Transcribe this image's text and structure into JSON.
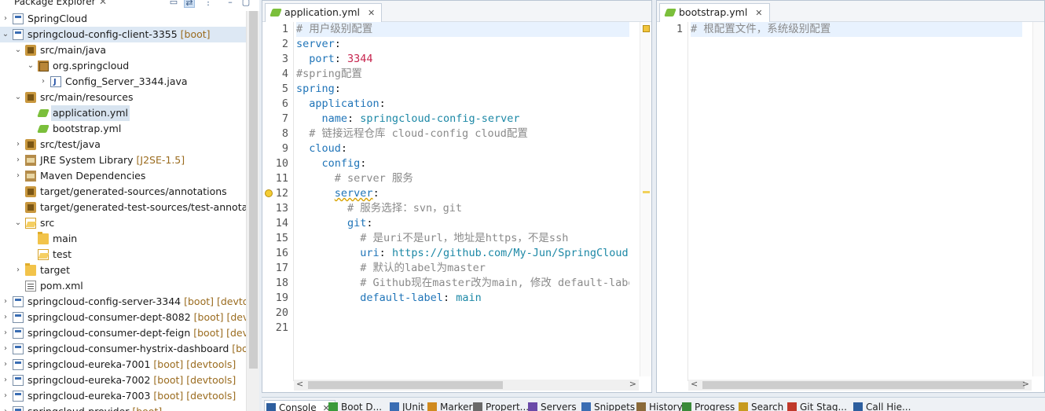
{
  "explorer": {
    "title": "Package Explorer",
    "close": "✕",
    "menu": "⋮",
    "rows": [
      {
        "label": "SpringCloud",
        "deco": "",
        "depth": 0,
        "twisty": "›",
        "icon": "ic-proj",
        "icon_name": "project-icon"
      },
      {
        "label": "springcloud-config-client-3355",
        "deco": " [boot]",
        "depth": 0,
        "twisty": "⌄",
        "icon": "ic-proj",
        "icon_name": "boot-project-icon",
        "highlight": true
      },
      {
        "label": "src/main/java",
        "deco": "",
        "depth": 1,
        "twisty": "⌄",
        "icon": "ic-pkgroot",
        "icon_name": "source-folder-icon"
      },
      {
        "label": "org.springcloud",
        "deco": "",
        "depth": 2,
        "twisty": "⌄",
        "icon": "ic-pkg",
        "icon_name": "package-icon"
      },
      {
        "label": "Config_Server_3344.java",
        "deco": "",
        "depth": 3,
        "twisty": "›",
        "icon": "ic-java",
        "icon_name": "java-file-icon"
      },
      {
        "label": "src/main/resources",
        "deco": "",
        "depth": 1,
        "twisty": "⌄",
        "icon": "ic-pkgroot",
        "icon_name": "source-folder-icon"
      },
      {
        "label": "application.yml",
        "deco": "",
        "depth": 2,
        "twisty": "",
        "icon": "ic-yml",
        "icon_name": "yaml-file-icon",
        "selected": true
      },
      {
        "label": "bootstrap.yml",
        "deco": "",
        "depth": 2,
        "twisty": "",
        "icon": "ic-yml",
        "icon_name": "yaml-file-icon"
      },
      {
        "label": "src/test/java",
        "deco": "",
        "depth": 1,
        "twisty": "›",
        "icon": "ic-pkgroot",
        "icon_name": "source-folder-icon"
      },
      {
        "label": "JRE System Library",
        "deco": " [J2SE-1.5]",
        "depth": 1,
        "twisty": "›",
        "icon": "ic-lib",
        "icon_name": "library-icon"
      },
      {
        "label": "Maven Dependencies",
        "deco": "",
        "depth": 1,
        "twisty": "›",
        "icon": "ic-lib",
        "icon_name": "library-icon"
      },
      {
        "label": "target/generated-sources/annotations",
        "deco": "",
        "depth": 1,
        "twisty": "",
        "icon": "ic-pkgroot",
        "icon_name": "source-folder-icon"
      },
      {
        "label": "target/generated-test-sources/test-annotations",
        "deco": "",
        "depth": 1,
        "twisty": "",
        "icon": "ic-pkgroot",
        "icon_name": "source-folder-icon"
      },
      {
        "label": "src",
        "deco": "",
        "depth": 1,
        "twisty": "⌄",
        "icon": "ic-folder-open",
        "icon_name": "folder-open-icon"
      },
      {
        "label": "main",
        "deco": "",
        "depth": 2,
        "twisty": "",
        "icon": "ic-folder",
        "icon_name": "folder-icon"
      },
      {
        "label": "test",
        "deco": "",
        "depth": 2,
        "twisty": "",
        "icon": "ic-folder-open",
        "icon_name": "folder-icon"
      },
      {
        "label": "target",
        "deco": "",
        "depth": 1,
        "twisty": "›",
        "icon": "ic-folder",
        "icon_name": "folder-icon"
      },
      {
        "label": "pom.xml",
        "deco": "",
        "depth": 1,
        "twisty": "",
        "icon": "ic-xml",
        "icon_name": "xml-file-icon"
      },
      {
        "label": "springcloud-config-server-3344",
        "deco": " [boot] [devtools]",
        "depth": 0,
        "twisty": "›",
        "icon": "ic-proj",
        "icon_name": "boot-project-icon"
      },
      {
        "label": "springcloud-consumer-dept-8082",
        "deco": " [boot] [devtools]",
        "depth": 0,
        "twisty": "›",
        "icon": "ic-proj",
        "icon_name": "boot-project-icon"
      },
      {
        "label": "springcloud-consumer-dept-feign",
        "deco": " [boot] [devtools]",
        "depth": 0,
        "twisty": "›",
        "icon": "ic-proj",
        "icon_name": "boot-project-icon"
      },
      {
        "label": "springcloud-consumer-hystrix-dashboard",
        "deco": " [boot]",
        "depth": 0,
        "twisty": "›",
        "icon": "ic-proj",
        "icon_name": "boot-project-icon"
      },
      {
        "label": "springcloud-eureka-7001",
        "deco": " [boot] [devtools]",
        "depth": 0,
        "twisty": "›",
        "icon": "ic-proj",
        "icon_name": "boot-project-icon"
      },
      {
        "label": "springcloud-eureka-7002",
        "deco": " [boot] [devtools]",
        "depth": 0,
        "twisty": "›",
        "icon": "ic-proj",
        "icon_name": "boot-project-icon"
      },
      {
        "label": "springcloud-eureka-7003",
        "deco": " [boot] [devtools]",
        "depth": 0,
        "twisty": "›",
        "icon": "ic-proj",
        "icon_name": "boot-project-icon"
      },
      {
        "label": "springcloud-provider",
        "deco": " [boot]",
        "depth": 0,
        "twisty": "›",
        "icon": "ic-proj",
        "icon_name": "boot-project-icon"
      }
    ]
  },
  "editor_app": {
    "tab_label": "application.yml",
    "tab_close": "✕",
    "lines": [
      [
        {
          "t": "# 用户级别配置",
          "c": "c"
        }
      ],
      [
        {
          "t": "server",
          "c": "k"
        },
        {
          "t": ":",
          "c": ""
        }
      ],
      [
        {
          "t": "  port",
          "c": "k"
        },
        {
          "t": ": ",
          "c": ""
        },
        {
          "t": "3344",
          "c": "n"
        }
      ],
      [
        {
          "t": "#spring配置",
          "c": "c"
        }
      ],
      [
        {
          "t": "spring",
          "c": "k"
        },
        {
          "t": ":",
          "c": ""
        }
      ],
      [
        {
          "t": "  application",
          "c": "k"
        },
        {
          "t": ":",
          "c": ""
        }
      ],
      [
        {
          "t": "    name",
          "c": "k"
        },
        {
          "t": ": ",
          "c": ""
        },
        {
          "t": "springcloud-config-server",
          "c": "v"
        }
      ],
      [
        {
          "t": "  # 链接远程仓库 cloud-config cloud配置",
          "c": "c"
        }
      ],
      [
        {
          "t": "  cloud",
          "c": "k"
        },
        {
          "t": ":",
          "c": ""
        }
      ],
      [
        {
          "t": "    config",
          "c": "k"
        },
        {
          "t": ":",
          "c": ""
        }
      ],
      [
        {
          "t": "      # server 服务",
          "c": "c"
        }
      ],
      [
        {
          "t": "      ",
          "c": ""
        },
        {
          "t": "server",
          "c": "k sq"
        },
        {
          "t": ":",
          "c": ""
        }
      ],
      [
        {
          "t": "        # 服务选择：svn，git",
          "c": "c"
        }
      ],
      [
        {
          "t": "        git",
          "c": "k"
        },
        {
          "t": ":",
          "c": ""
        }
      ],
      [
        {
          "t": "          # 是uri不是url，地址是https，不是ssh",
          "c": "c"
        }
      ],
      [
        {
          "t": "          uri",
          "c": "k"
        },
        {
          "t": ": ",
          "c": ""
        },
        {
          "t": "https://github.com/My-Jun/SpringCloud-Config.git",
          "c": "v"
        }
      ],
      [
        {
          "t": "          # 默认的label为master",
          "c": "c"
        }
      ],
      [
        {
          "t": "          # Github现在master改为main, 修改 default-label",
          "c": "c"
        }
      ],
      [
        {
          "t": "          default-label",
          "c": "k"
        },
        {
          "t": ": ",
          "c": ""
        },
        {
          "t": "main",
          "c": "v"
        }
      ],
      [],
      []
    ],
    "line_numbers": [
      "1",
      "2",
      "3",
      "4",
      "5",
      "6",
      "7",
      "8",
      "9",
      "10",
      "11",
      "12",
      "13",
      "14",
      "15",
      "16",
      "17",
      "18",
      "19",
      "20",
      "21"
    ],
    "warning_line": 12
  },
  "editor_boot": {
    "tab_label": "bootstrap.yml",
    "tab_close": "✕",
    "lines": [
      [
        {
          "t": "# 根配置文件，系统级别配置",
          "c": "c"
        }
      ]
    ],
    "line_numbers": [
      "1"
    ]
  },
  "bottom_tabs": [
    {
      "label": "Console",
      "icon": "console-icon",
      "color": "#2d5e9e",
      "active": true,
      "close": "✕"
    },
    {
      "label": "Boot D...",
      "icon": "boot-dashboard-icon",
      "color": "#3a9a3a"
    },
    {
      "label": "JUnit",
      "icon": "junit-icon",
      "color": "#3a6db3"
    },
    {
      "label": "Markers",
      "icon": "markers-icon",
      "color": "#d08a1e"
    },
    {
      "label": "Propert...",
      "icon": "properties-icon",
      "color": "#6a6a6a"
    },
    {
      "label": "Servers",
      "icon": "servers-icon",
      "color": "#6a4aa8"
    },
    {
      "label": "Snippets",
      "icon": "snippets-icon",
      "color": "#3a6db3"
    },
    {
      "label": "History",
      "icon": "history-icon",
      "color": "#8a6a3a"
    },
    {
      "label": "Progress",
      "icon": "progress-icon",
      "color": "#3a8a3a"
    },
    {
      "label": "Search",
      "icon": "search-icon",
      "color": "#c79a1e"
    },
    {
      "label": "Git Stag...",
      "icon": "git-staging-icon",
      "color": "#c0392b"
    },
    {
      "label": "Call Hie...",
      "icon": "call-hierarchy-icon",
      "color": "#2d5e9e"
    }
  ]
}
